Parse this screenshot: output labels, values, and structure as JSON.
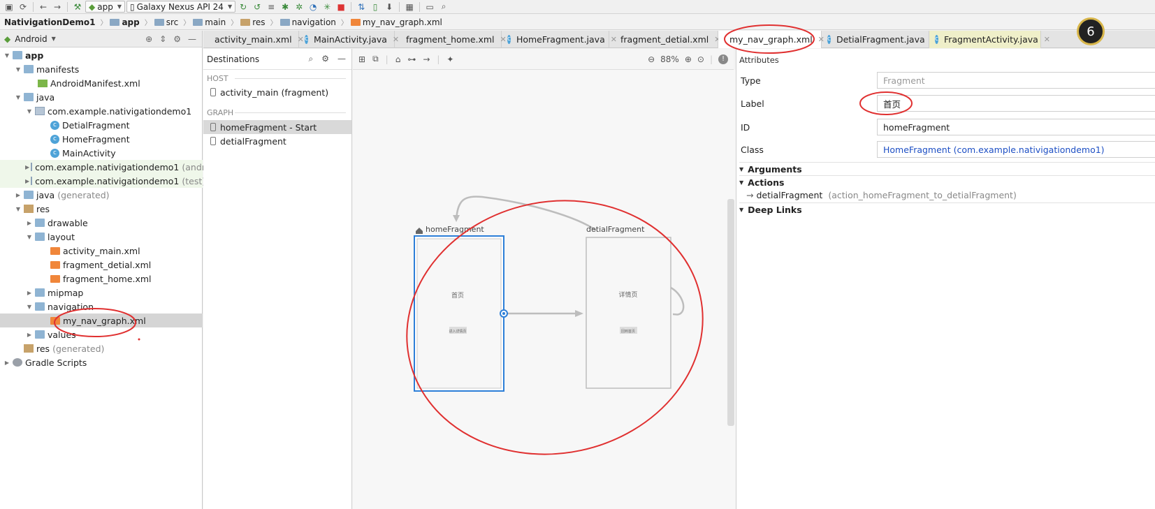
{
  "toolbar": {
    "run_config": "app",
    "device": "Galaxy Nexus API 24"
  },
  "breadcrumb": [
    "NativigationDemo1",
    "app",
    "src",
    "main",
    "res",
    "navigation",
    "my_nav_graph.xml"
  ],
  "project_panel": {
    "view": "Android",
    "tree": [
      {
        "label": "app",
        "note": ""
      },
      {
        "label": "manifests",
        "note": ""
      },
      {
        "label": "AndroidManifest.xml",
        "note": ""
      },
      {
        "label": "java",
        "note": ""
      },
      {
        "label": "com.example.nativigationdemo1",
        "note": ""
      },
      {
        "label": "DetialFragment",
        "note": ""
      },
      {
        "label": "HomeFragment",
        "note": ""
      },
      {
        "label": "MainActivity",
        "note": ""
      },
      {
        "label": "com.example.nativigationdemo1",
        "note": "(andro"
      },
      {
        "label": "com.example.nativigationdemo1",
        "note": "(test)"
      },
      {
        "label": "java",
        "note": "(generated)"
      },
      {
        "label": "res",
        "note": ""
      },
      {
        "label": "drawable",
        "note": ""
      },
      {
        "label": "layout",
        "note": ""
      },
      {
        "label": "activity_main.xml",
        "note": ""
      },
      {
        "label": "fragment_detial.xml",
        "note": ""
      },
      {
        "label": "fragment_home.xml",
        "note": ""
      },
      {
        "label": "mipmap",
        "note": ""
      },
      {
        "label": "navigation",
        "note": ""
      },
      {
        "label": "my_nav_graph.xml",
        "note": ""
      },
      {
        "label": "values",
        "note": ""
      },
      {
        "label": "res",
        "note": "(generated)"
      },
      {
        "label": "Gradle Scripts",
        "note": ""
      }
    ]
  },
  "tabs": [
    {
      "label": "activity_main.xml"
    },
    {
      "label": "MainActivity.java"
    },
    {
      "label": "fragment_home.xml"
    },
    {
      "label": "HomeFragment.java"
    },
    {
      "label": "fragment_detial.xml"
    },
    {
      "label": "my_nav_graph.xml"
    },
    {
      "label": "DetialFragment.java"
    },
    {
      "label": "FragmentActivity.java"
    }
  ],
  "destinations": {
    "title": "Destinations",
    "host_label": "HOST",
    "host_item": "activity_main (fragment)",
    "graph_label": "GRAPH",
    "graph_items": [
      "homeFragment - Start",
      "detialFragment"
    ]
  },
  "canvas": {
    "zoom": "88%",
    "home_label": "homeFragment",
    "home_text": "首页",
    "home_button": "进入详情页",
    "detail_label": "detialFragment",
    "detail_text": "详情页",
    "detail_button": "回到首页"
  },
  "attributes": {
    "title": "Attributes",
    "type_label": "Type",
    "type_value": "Fragment",
    "label_label": "Label",
    "label_value": "首页",
    "id_label": "ID",
    "id_value": "homeFragment",
    "class_label": "Class",
    "class_value": "HomeFragment (com.example.nativigationdemo1)",
    "arguments": "Arguments",
    "actions": "Actions",
    "action_item": "detialFragment",
    "action_note": "(action_homeFragment_to_detialFragment)",
    "deep_links": "Deep Links"
  },
  "badge": "6",
  "colors": {
    "annotation": "#e03030",
    "selection": "#2d7fd8"
  }
}
